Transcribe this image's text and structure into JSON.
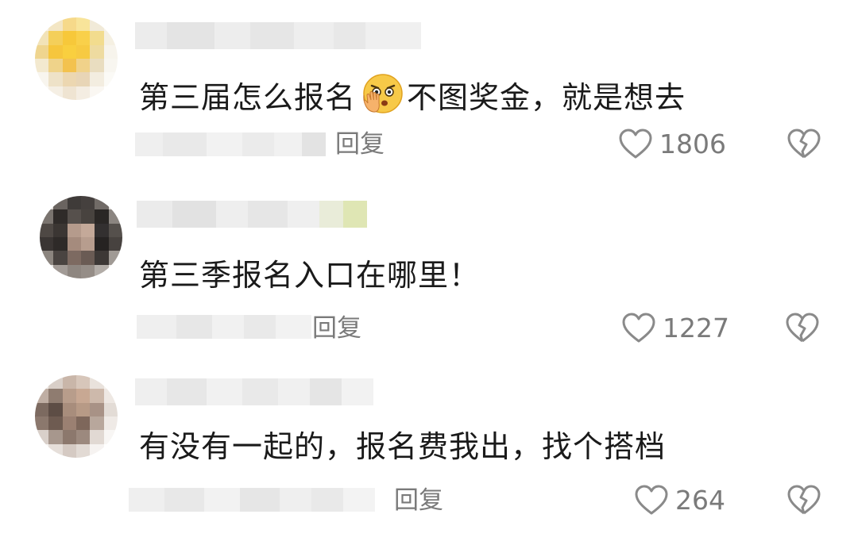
{
  "comments": [
    {
      "text_before_emoji": "第三届怎么报名",
      "emoji": "stop-hand-emoji",
      "text_after_emoji": "不图奖金，就是想去",
      "reply_label": "回复",
      "like_count": "1806"
    },
    {
      "text": "第三季报名入口在哪里！",
      "reply_label": "回复",
      "like_count": "1227"
    },
    {
      "text": "有没有一起的，报名费我出，找个搭档",
      "reply_label": "回复",
      "like_count": "264"
    }
  ],
  "icons": {
    "like": "heart-outline-icon",
    "dislike": "broken-heart-icon"
  },
  "colors": {
    "text": "#1a1a1a",
    "meta": "#7a7a7a",
    "icon": "#8a8a8a"
  }
}
